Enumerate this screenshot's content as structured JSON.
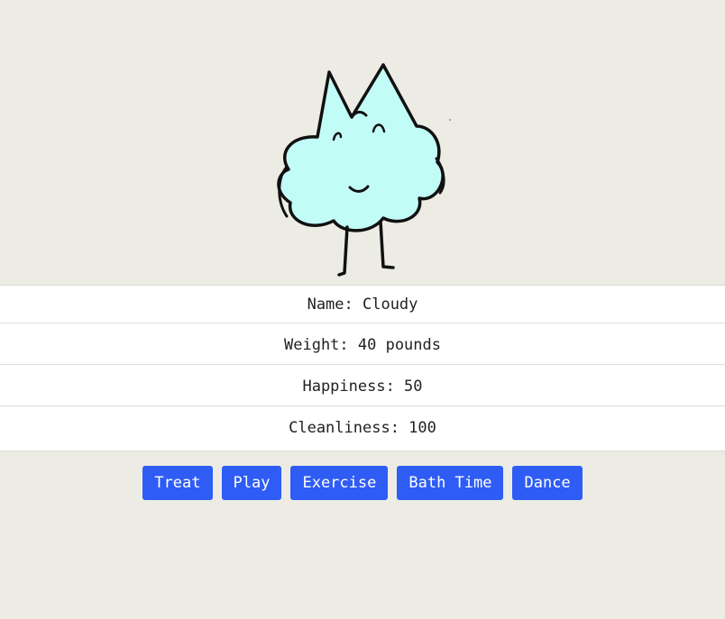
{
  "colors": {
    "background": "#ecece4",
    "panel": "#ffffff",
    "button": "#2f5cf5",
    "button_text": "#ffffff",
    "pet_fill": "#c2fcf6"
  },
  "pet": {
    "icon": "cloud-creature-drawing"
  },
  "stats": {
    "name": "Name: Cloudy",
    "weight": "Weight: 40 pounds",
    "happiness": "Happiness: 50",
    "cleanliness": "Cleanliness: 100"
  },
  "actions": {
    "treat": "Treat",
    "play": "Play",
    "exercise": "Exercise",
    "bath_time": "Bath Time",
    "dance": "Dance"
  }
}
